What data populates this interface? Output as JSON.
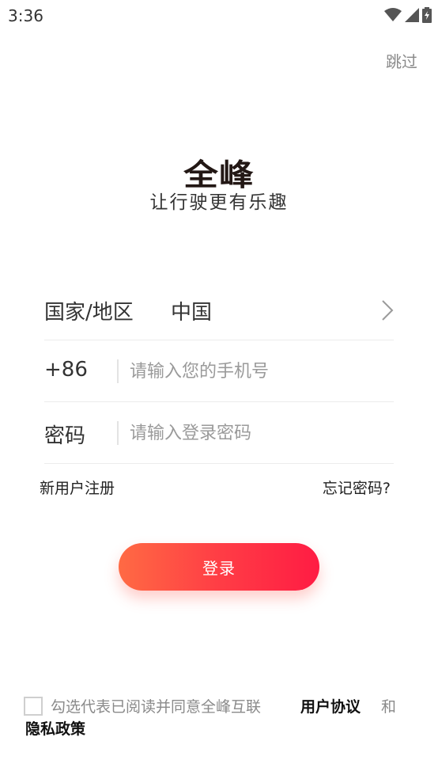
{
  "status_bar": {
    "time": "3:36",
    "icons": [
      "wifi-icon",
      "signal-icon",
      "battery-charging-icon"
    ]
  },
  "header": {
    "skip_label": "跳过"
  },
  "brand": {
    "logo_text": "全峰",
    "slogan": "让行驶更有乐趣"
  },
  "form": {
    "region_label": "国家/地区",
    "region_value": "中国",
    "phone_prefix": "+86",
    "phone_placeholder": "请输入您的手机号",
    "phone_value": "",
    "password_label": "密码",
    "password_placeholder": "请输入登录密码",
    "password_value": ""
  },
  "links": {
    "register": "新用户注册",
    "forgot_password": "忘记密码?"
  },
  "login_button": {
    "label": "登录",
    "gradient_start": "#ff6a44",
    "gradient_end": "#ff1c44"
  },
  "agreement": {
    "checked": false,
    "text": "勾选代表已阅读并同意全峰互联",
    "user_agreement": "用户协议",
    "and": "和",
    "privacy_policy": "隐私政策"
  }
}
